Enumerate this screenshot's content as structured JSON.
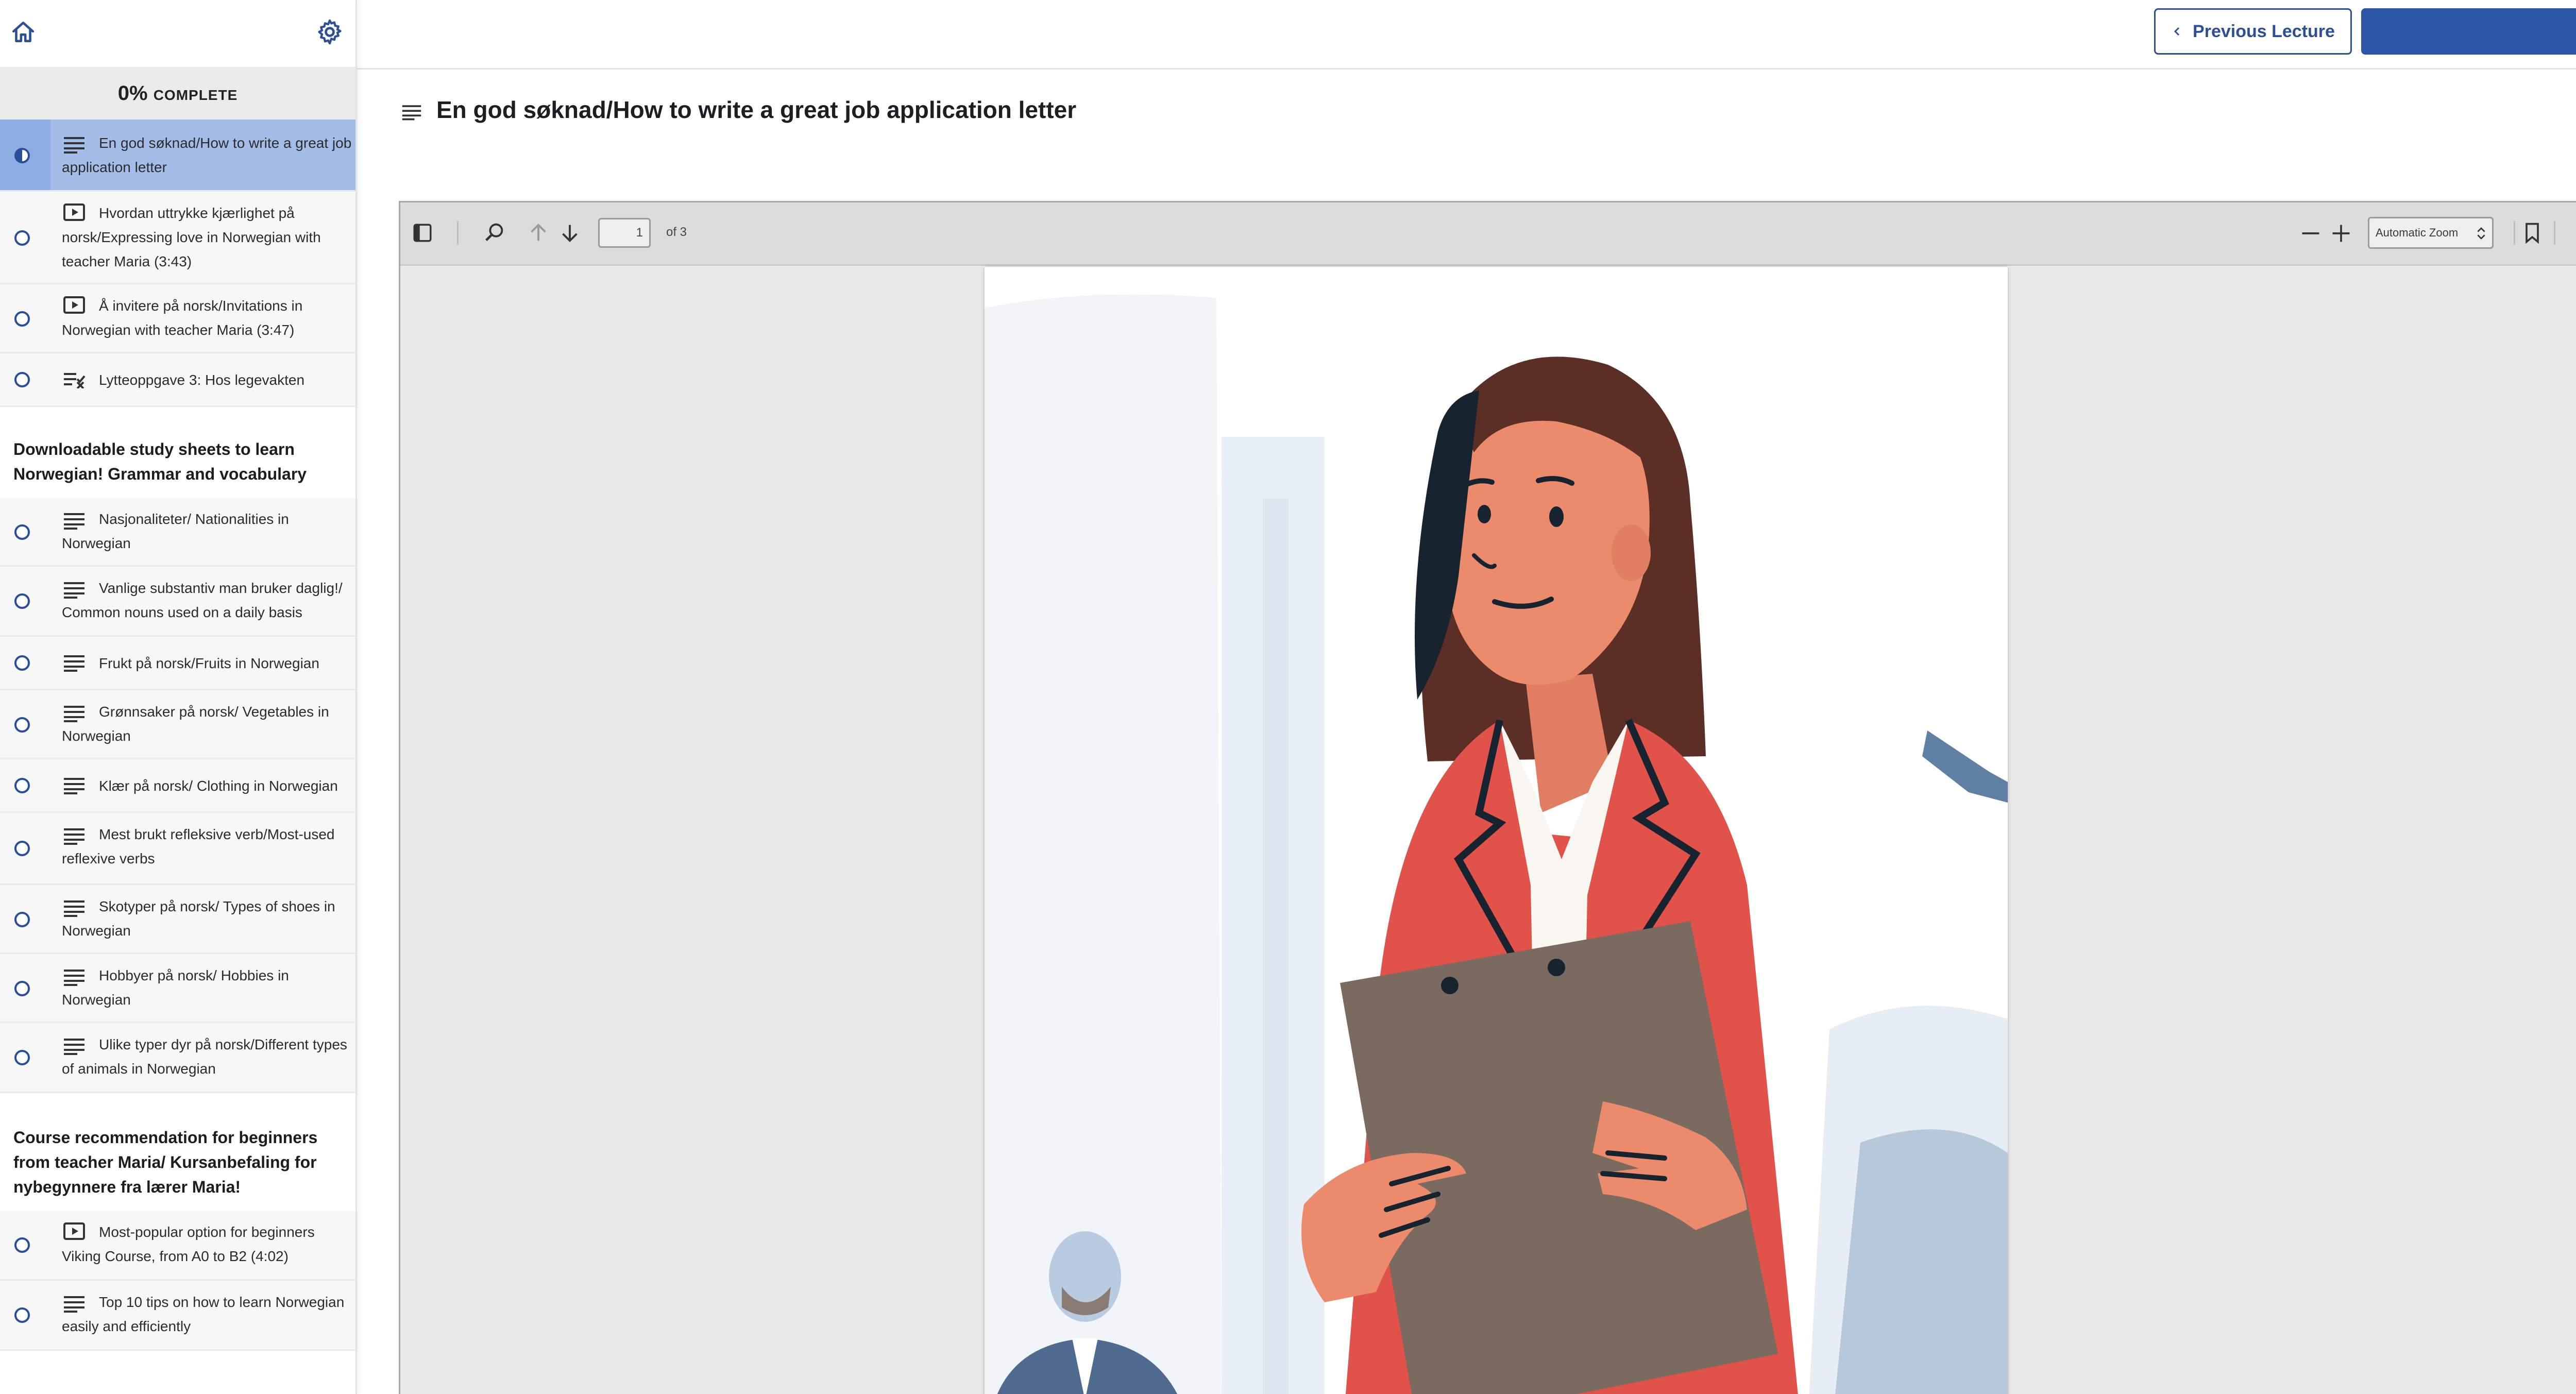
{
  "sidebar": {
    "progress_percent": "0%",
    "progress_label": "COMPLETE",
    "lessons_a": [
      {
        "title": "En god søknad/How to write a great job application letter",
        "type": "text-icon",
        "active": true
      },
      {
        "title": "Hvordan uttrykke kjærlighet på norsk/Expressing love in Norwegian with teacher Maria (3:43)",
        "type": "video-icon"
      },
      {
        "title": "Å invitere på norsk/Invitations in Norwegian with teacher Maria (3:47)",
        "type": "video-icon"
      },
      {
        "title": "Lytteoppgave 3: Hos legevakten",
        "type": "quiz-icon"
      }
    ],
    "section_b_title": "Downloadable study sheets to learn Norwegian! Grammar and vocabulary",
    "lessons_b": [
      {
        "title": "Nasjonaliteter/ Nationalities in Norwegian",
        "type": "text-icon"
      },
      {
        "title": "Vanlige substantiv man bruker daglig!/ Common nouns used on a daily basis",
        "type": "text-icon"
      },
      {
        "title": "Frukt på norsk/Fruits in Norwegian",
        "type": "text-icon"
      },
      {
        "title": "Grønnsaker på norsk/ Vegetables in Norwegian",
        "type": "text-icon"
      },
      {
        "title": "Klær på norsk/ Clothing in Norwegian",
        "type": "text-icon"
      },
      {
        "title": "Mest brukt refleksive verb/Most-used reflexive verbs",
        "type": "text-icon"
      },
      {
        "title": "Skotyper på norsk/ Types of shoes in Norwegian",
        "type": "text-icon"
      },
      {
        "title": "Hobbyer på norsk/ Hobbies in Norwegian",
        "type": "text-icon"
      },
      {
        "title": "Ulike typer dyr på norsk/Different types of animals in Norwegian",
        "type": "text-icon"
      }
    ],
    "section_c_title": "Course recommendation for beginners from teacher Maria/ Kursanbefaling for nybegynnere fra lærer Maria!",
    "lessons_c": [
      {
        "title": "Most-popular option for beginners Viking Course, from A0 to B2 (4:02)",
        "type": "video-icon"
      },
      {
        "title": "Top 10 tips on how to learn Norwegian easily and efficiently",
        "type": "text-icon"
      }
    ]
  },
  "topbar": {
    "prev_label": "Previous Lecture",
    "next_label": ""
  },
  "lecture": {
    "title": "En god søknad/How to write a great job application letter"
  },
  "pdf_viewer": {
    "page_number": "1",
    "page_count_label": "of 3",
    "zoom_label": "Automatic Zoom"
  },
  "colors": {
    "accent": "#2e56a6",
    "active_lesson": "#a4bde8",
    "jacket": "#e0524a",
    "clipboard": "#7a6a60",
    "skin": "#ec8a6c"
  }
}
